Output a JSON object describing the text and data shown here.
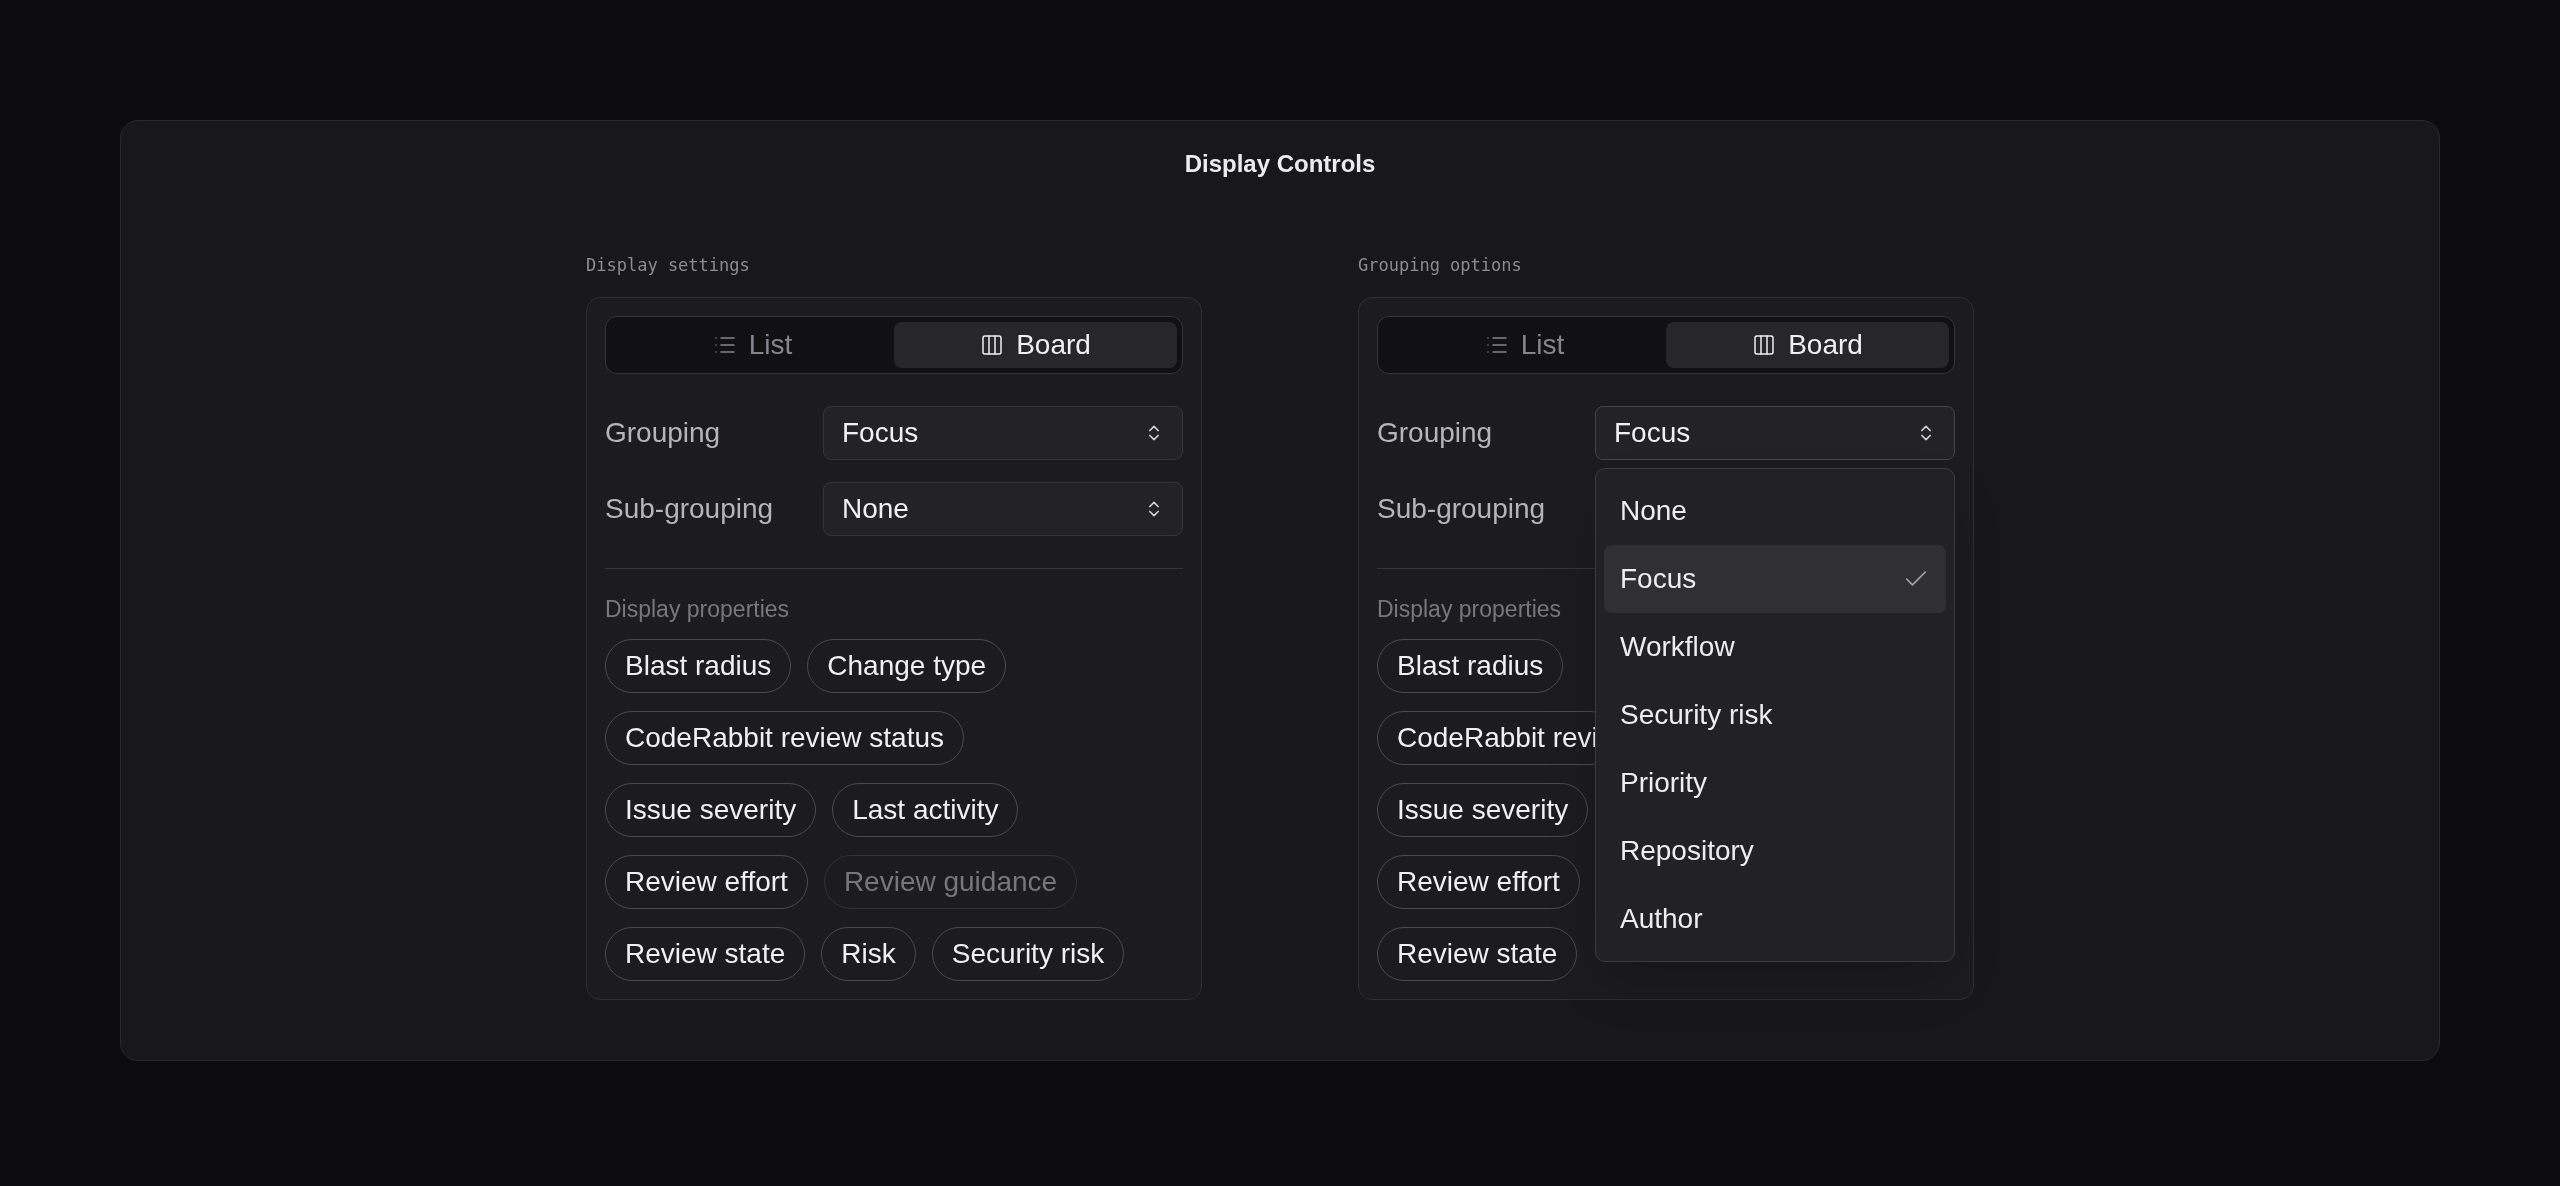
{
  "title": "Display Controls",
  "panels": [
    {
      "caption": "Display settings",
      "tabs": [
        {
          "label": "List",
          "kind": "list",
          "selected": false
        },
        {
          "label": "Board",
          "kind": "board",
          "selected": true
        }
      ],
      "selects": [
        {
          "label": "Grouping",
          "value": "Focus"
        },
        {
          "label": "Sub-grouping",
          "value": "None"
        }
      ],
      "properties_label": "Display properties",
      "property_rows": [
        [
          {
            "label": "Blast radius",
            "on": true
          },
          {
            "label": "Change type",
            "on": true
          }
        ],
        [
          {
            "label": "CodeRabbit review status",
            "on": true
          }
        ],
        [
          {
            "label": "Issue severity",
            "on": true
          },
          {
            "label": "Last activity",
            "on": true
          }
        ],
        [
          {
            "label": "Review effort",
            "on": true
          },
          {
            "label": "Review guidance",
            "on": false
          }
        ],
        [
          {
            "label": "Review state",
            "on": true
          },
          {
            "label": "Risk",
            "on": true
          },
          {
            "label": "Security risk",
            "on": true
          }
        ]
      ]
    },
    {
      "caption": "Grouping options",
      "tabs": [
        {
          "label": "List",
          "kind": "list",
          "selected": false
        },
        {
          "label": "Board",
          "kind": "board",
          "selected": true
        }
      ],
      "selects": [
        {
          "label": "Grouping",
          "value": "Focus",
          "expanded": true
        },
        {
          "label": "Sub-grouping"
        }
      ],
      "properties_label": "Display properties",
      "property_rows": [
        [
          {
            "label": "Blast radius",
            "on": true
          }
        ],
        [
          {
            "label": "CodeRabbit revi",
            "on": true
          }
        ],
        [
          {
            "label": "Issue severity",
            "on": true
          }
        ],
        [
          {
            "label": "Review effort",
            "on": true
          }
        ],
        [
          {
            "label": "Review state",
            "on": true
          }
        ]
      ],
      "dropdown": [
        {
          "label": "None",
          "selected": false
        },
        {
          "label": "Focus",
          "selected": true
        },
        {
          "label": "Workflow",
          "selected": false
        },
        {
          "label": "Security risk",
          "selected": false
        },
        {
          "label": "Priority",
          "selected": false
        },
        {
          "label": "Repository",
          "selected": false
        },
        {
          "label": "Author",
          "selected": false
        }
      ]
    }
  ]
}
